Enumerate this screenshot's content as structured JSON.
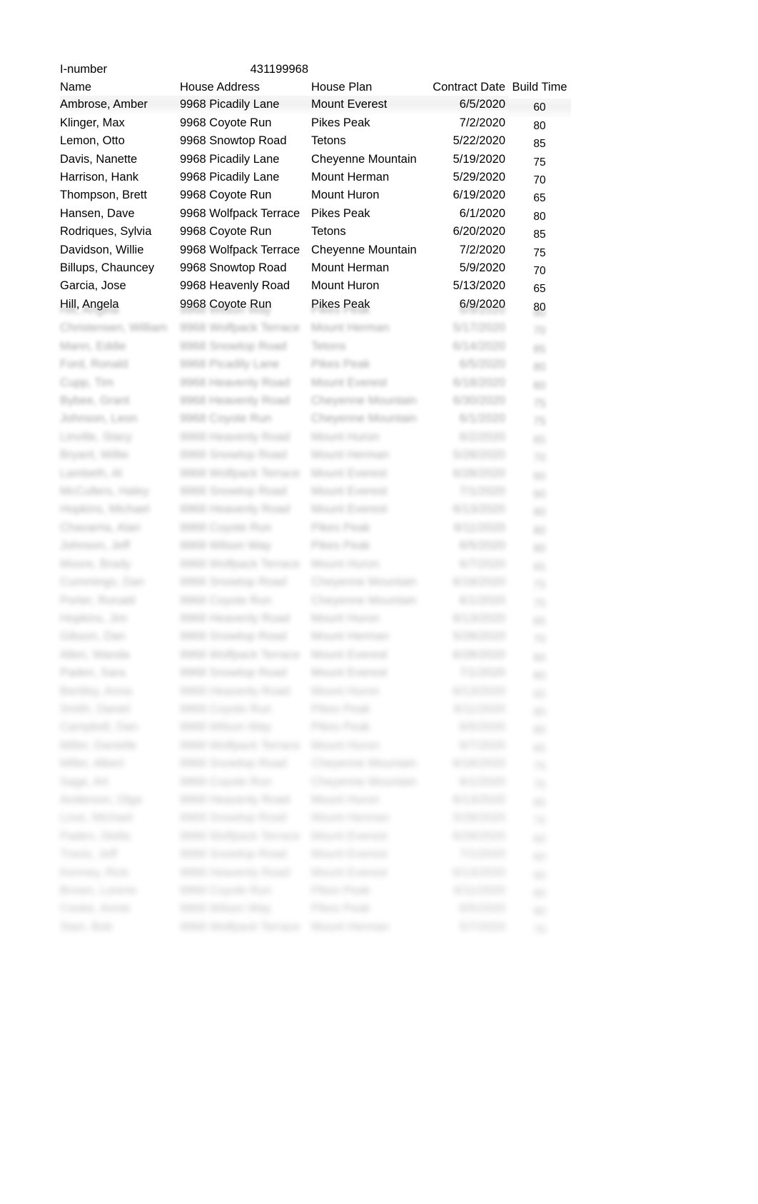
{
  "document": {
    "meta": {
      "label": "I-number",
      "value": "431199968"
    },
    "table": {
      "headers": {
        "name": "Name",
        "address": "House Address",
        "plan": "House Plan",
        "date": "Contract Date",
        "build": "Build Time"
      },
      "rows": [
        {
          "name": "Ambrose,  Amber",
          "address": "9968 Picadily Lane",
          "plan": "Mount Everest",
          "date": "6/5/2020",
          "build": "60"
        },
        {
          "name": "Klinger, Max",
          "address": "9968 Coyote Run",
          "plan": "Pikes Peak",
          "date": "7/2/2020",
          "build": "80"
        },
        {
          "name": "Lemon,  Otto",
          "address": "9968 Snowtop Road",
          "plan": "Tetons",
          "date": "5/22/2020",
          "build": "85"
        },
        {
          "name": "Davis,  Nanette",
          "address": "9968 Picadily Lane",
          "plan": "Cheyenne Mountain",
          "date": "5/19/2020",
          "build": "75"
        },
        {
          "name": "Harrison,  Hank",
          "address": "9968 Picadily Lane",
          "plan": "Mount Herman",
          "date": "5/29/2020",
          "build": "70"
        },
        {
          "name": "Thompson,  Brett",
          "address": "9968 Coyote Run",
          "plan": "Mount Huron",
          "date": "6/19/2020",
          "build": "65"
        },
        {
          "name": "Hansen, Dave",
          "address": "9968 Wolfpack Terrace",
          "plan": "Pikes Peak",
          "date": "6/1/2020",
          "build": "80"
        },
        {
          "name": "Rodriques,  Sylvia",
          "address": "9968 Coyote Run",
          "plan": "Tetons",
          "date": "6/20/2020",
          "build": "85"
        },
        {
          "name": "Davidson,  Willie",
          "address": "9968 Wolfpack Terrace",
          "plan": "Cheyenne Mountain",
          "date": "7/2/2020",
          "build": "75"
        },
        {
          "name": "Billups,  Chauncey",
          "address": "9968 Snowtop Road",
          "plan": "Mount Herman",
          "date": "5/9/2020",
          "build": "70"
        },
        {
          "name": "Garcia,  Jose",
          "address": "9968 Heavenly Road",
          "plan": "Mount Huron",
          "date": "5/13/2020",
          "build": "65"
        },
        {
          "name": "Hill,  Angela",
          "address": "9968 Coyote Run",
          "plan": "Pikes Peak",
          "date": "6/9/2020",
          "build": "80"
        }
      ],
      "obscured_rows": [
        {
          "name": "Hill,  Angela",
          "address": "9968 Wilson Way",
          "plan": "Pikes Peak",
          "date": "6/9/2020",
          "build": "80"
        },
        {
          "name": "Christensen,  William",
          "address": "9968 Wolfpack Terrace",
          "plan": "Mount Herman",
          "date": "5/17/2020",
          "build": "70"
        },
        {
          "name": "Mann,  Eddie",
          "address": "9968 Snowtop Road",
          "plan": "Tetons",
          "date": "6/14/2020",
          "build": "85"
        },
        {
          "name": "Ford,  Ronald",
          "address": "9968 Picadily Lane",
          "plan": "Pikes Peak",
          "date": "6/5/2020",
          "build": "80"
        },
        {
          "name": "Cupp,  Tim",
          "address": "9968 Heavenly Road",
          "plan": "Mount Everest",
          "date": "6/18/2020",
          "build": "60"
        },
        {
          "name": "Bybee,  Grant",
          "address": "9968 Heavenly Road",
          "plan": "Cheyenne Mountain",
          "date": "6/30/2020",
          "build": "75"
        },
        {
          "name": "Johnson,  Leon",
          "address": "9968 Coyote Run",
          "plan": "Cheyenne Mountain",
          "date": "6/1/2020",
          "build": "75"
        },
        {
          "name": "Linville,  Stacy",
          "address": "9968 Heavenly Road",
          "plan": "Mount Huron",
          "date": "6/2/2020",
          "build": "65"
        },
        {
          "name": "Bryant,  Willie",
          "address": "9968 Snowtop Road",
          "plan": "Mount Herman",
          "date": "5/28/2020",
          "build": "70"
        },
        {
          "name": "Lambeth,  Al",
          "address": "9968 Wolfpack Terrace",
          "plan": "Mount Everest",
          "date": "6/28/2020",
          "build": "60"
        },
        {
          "name": "McCullers,  Haley",
          "address": "9968 Snowtop Road",
          "plan": "Mount Everest",
          "date": "7/1/2020",
          "build": "60"
        },
        {
          "name": "Hopkins,  Michael",
          "address": "9968 Heavenly Road",
          "plan": "Mount Everest",
          "date": "6/13/2020",
          "build": "60"
        },
        {
          "name": "Chavarria,  Alan",
          "address": "9968 Coyote Run",
          "plan": "Pikes Peak",
          "date": "6/11/2020",
          "build": "80"
        },
        {
          "name": "Johnson,  Jeff",
          "address": "9968 Wilson Way",
          "plan": "Pikes Peak",
          "date": "6/5/2020",
          "build": "80"
        },
        {
          "name": "Moore,  Brady",
          "address": "9968 Wolfpack Terrace",
          "plan": "Mount Huron",
          "date": "6/7/2020",
          "build": "65"
        },
        {
          "name": "Cummings,  Dan",
          "address": "9968 Snowtop Road",
          "plan": "Cheyenne Mountain",
          "date": "6/18/2020",
          "build": "75"
        },
        {
          "name": "Porter,  Ronald",
          "address": "9968 Coyote Run",
          "plan": "Cheyenne Mountain",
          "date": "6/1/2020",
          "build": "75"
        },
        {
          "name": "Hopkins,  Jim",
          "address": "9968 Heavenly Road",
          "plan": "Mount Huron",
          "date": "6/13/2020",
          "build": "65"
        },
        {
          "name": "Gibson,  Dan",
          "address": "9968 Snowtop Road",
          "plan": "Mount Herman",
          "date": "5/28/2020",
          "build": "70"
        },
        {
          "name": "Allen,  Wanda",
          "address": "9968 Wolfpack Terrace",
          "plan": "Mount Everest",
          "date": "6/28/2020",
          "build": "60"
        },
        {
          "name": "Paden,  Sara",
          "address": "9968 Snowtop Road",
          "plan": "Mount Everest",
          "date": "7/1/2020",
          "build": "60"
        },
        {
          "name": "Bentley,  Anna",
          "address": "9968 Heavenly Road",
          "plan": "Mount Huron",
          "date": "6/13/2020",
          "build": "65"
        },
        {
          "name": "Smith,  Daniel",
          "address": "9968 Coyote Run",
          "plan": "Pikes Peak",
          "date": "6/11/2020",
          "build": "80"
        },
        {
          "name": "Campbell,  Dan",
          "address": "9968 Wilson Way",
          "plan": "Pikes Peak",
          "date": "6/5/2020",
          "build": "80"
        },
        {
          "name": "Miller,  Danielle",
          "address": "9968 Wolfpack Terrace",
          "plan": "Mount Huron",
          "date": "6/7/2020",
          "build": "65"
        },
        {
          "name": "Miller,  Albert",
          "address": "9968 Snowtop Road",
          "plan": "Cheyenne Mountain",
          "date": "6/18/2020",
          "build": "75"
        },
        {
          "name": "Sage,  Art",
          "address": "9968 Coyote Run",
          "plan": "Cheyenne Mountain",
          "date": "6/1/2020",
          "build": "75"
        },
        {
          "name": "Anderson,  Olga",
          "address": "9968 Heavenly Road",
          "plan": "Mount Huron",
          "date": "6/13/2020",
          "build": "65"
        },
        {
          "name": "Love,  Michael",
          "address": "9968 Snowtop Road",
          "plan": "Mount Herman",
          "date": "5/28/2020",
          "build": "70"
        },
        {
          "name": "Paden,  Stella",
          "address": "9968 Wolfpack Terrace",
          "plan": "Mount Everest",
          "date": "6/28/2020",
          "build": "60"
        },
        {
          "name": "Travis,  Jeff",
          "address": "9968 Snowtop Road",
          "plan": "Mount Everest",
          "date": "7/1/2020",
          "build": "60"
        },
        {
          "name": "Kenney,  Rick",
          "address": "9968 Heavenly Road",
          "plan": "Mount Everest",
          "date": "6/13/2020",
          "build": "60"
        },
        {
          "name": "Brown,  Lorene",
          "address": "9968 Coyote Run",
          "plan": "Pikes Peak",
          "date": "6/11/2020",
          "build": "80"
        },
        {
          "name": "Cooke,  Annie",
          "address": "9968 Wilson Way",
          "plan": "Pikes Peak",
          "date": "6/5/2020",
          "build": "80"
        },
        {
          "name": "Starr,  Bob",
          "address": "9968 Wolfpack Terrace",
          "plan": "Mount Herman",
          "date": "5/7/2020",
          "build": "70"
        }
      ]
    }
  }
}
